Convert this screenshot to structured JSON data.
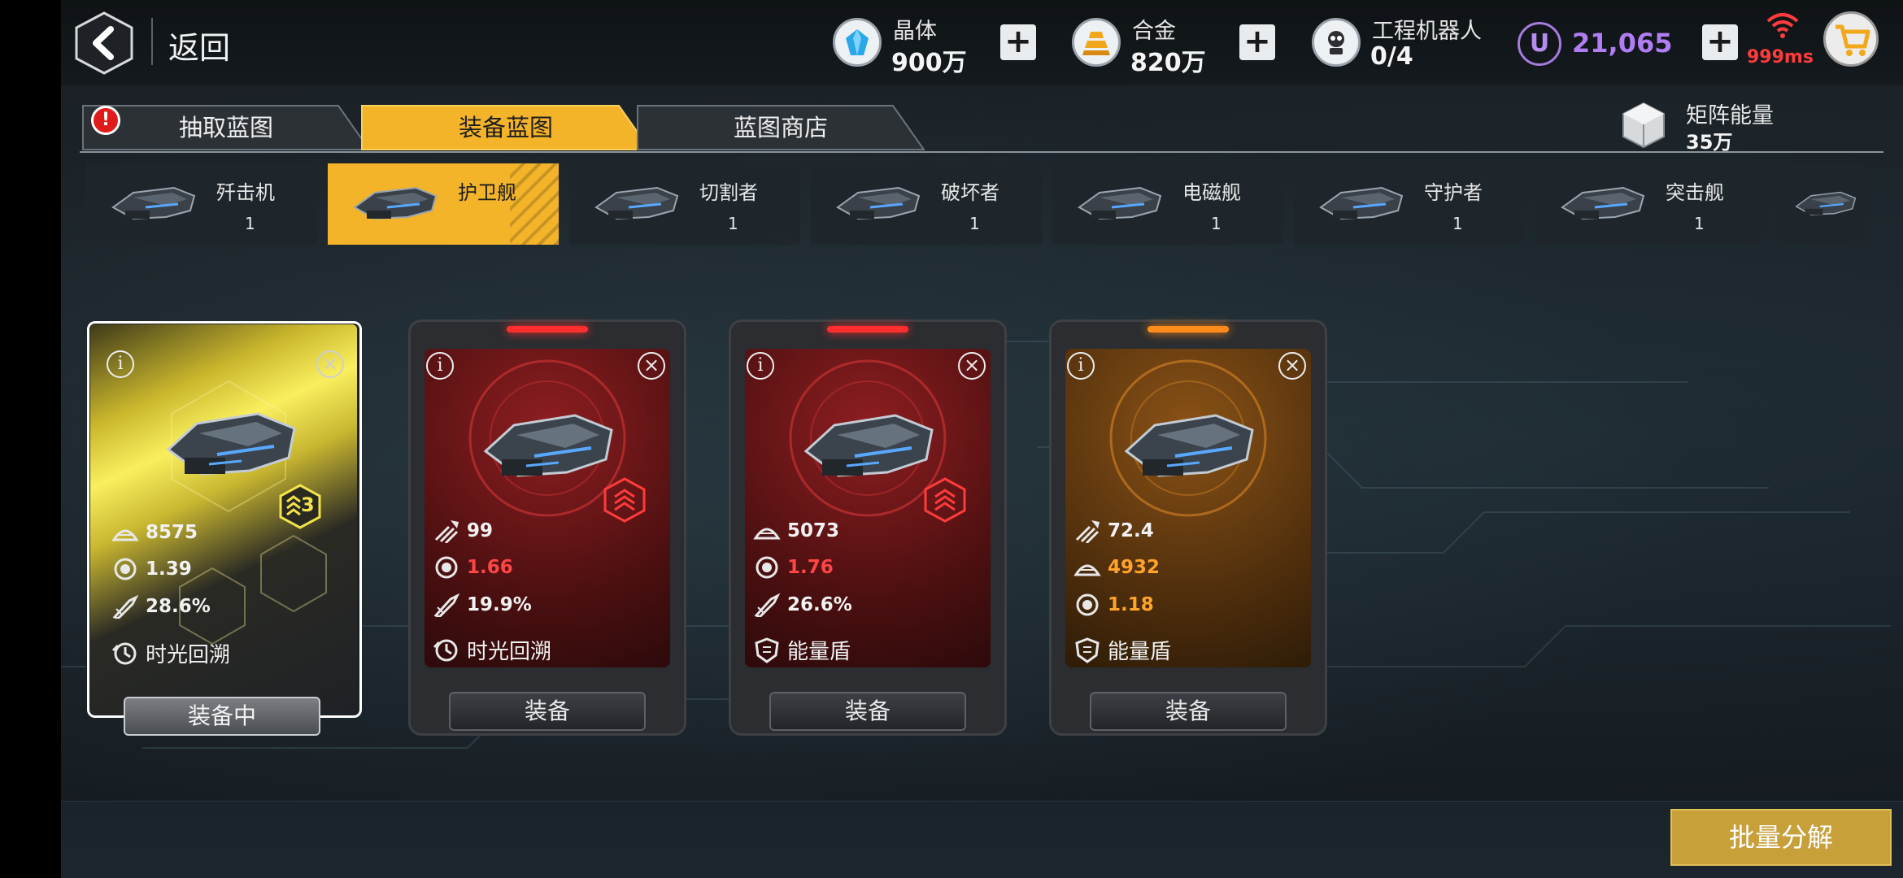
{
  "header": {
    "back_label": "返回",
    "resources": [
      {
        "name": "晶体",
        "value": "900万",
        "icon": "crystal-icon"
      },
      {
        "name": "合金",
        "value": "820万",
        "icon": "alloy-icon"
      },
      {
        "name": "工程机器人",
        "value": "0/4",
        "icon": "robot-icon"
      }
    ],
    "currency": {
      "symbol": "U",
      "value": "21,065"
    },
    "ping": "999ms"
  },
  "tabs": [
    {
      "label": "抽取蓝图",
      "active": false,
      "alert": "!"
    },
    {
      "label": "装备蓝图",
      "active": true
    },
    {
      "label": "蓝图商店",
      "active": false
    }
  ],
  "matrix": {
    "name": "矩阵能量",
    "value": "35万"
  },
  "ship_types": [
    {
      "name": "歼击机",
      "count": "1",
      "active": false
    },
    {
      "name": "护卫舰",
      "count": "",
      "active": true
    },
    {
      "name": "切割者",
      "count": "1",
      "active": false
    },
    {
      "name": "破坏者",
      "count": "1",
      "active": false
    },
    {
      "name": "电磁舰",
      "count": "1",
      "active": false
    },
    {
      "name": "守护者",
      "count": "1",
      "active": false
    },
    {
      "name": "突击舰",
      "count": "1",
      "active": false
    }
  ],
  "cards": [
    {
      "rarity": "gold",
      "rank": "3",
      "stats": [
        {
          "icon": "armor-icon",
          "value": "8575",
          "color": "white"
        },
        {
          "icon": "energy-icon",
          "value": "1.39",
          "color": "white"
        },
        {
          "icon": "rocket-icon",
          "value": "28.6%",
          "color": "white"
        }
      ],
      "skill": {
        "icon": "time-rewind-icon",
        "label": "时光回溯"
      },
      "button": "装备中"
    },
    {
      "rarity": "red",
      "stats": [
        {
          "icon": "damage-icon",
          "value": "99",
          "color": "white"
        },
        {
          "icon": "energy-icon",
          "value": "1.66",
          "color": "red"
        },
        {
          "icon": "rocket-icon",
          "value": "19.9%",
          "color": "white"
        }
      ],
      "skill": {
        "icon": "time-rewind-icon",
        "label": "时光回溯"
      },
      "button": "装备"
    },
    {
      "rarity": "red",
      "stats": [
        {
          "icon": "armor-icon",
          "value": "5073",
          "color": "white"
        },
        {
          "icon": "energy-icon",
          "value": "1.76",
          "color": "red"
        },
        {
          "icon": "rocket-icon",
          "value": "26.6%",
          "color": "white"
        }
      ],
      "skill": {
        "icon": "shield-icon",
        "label": "能量盾"
      },
      "button": "装备"
    },
    {
      "rarity": "orange",
      "stats": [
        {
          "icon": "damage-icon",
          "value": "72.4",
          "color": "white"
        },
        {
          "icon": "armor-icon",
          "value": "4932",
          "color": "orange"
        },
        {
          "icon": "energy-icon",
          "value": "1.18",
          "color": "orange"
        }
      ],
      "skill": {
        "icon": "shield-icon",
        "label": "能量盾"
      },
      "button": "装备"
    }
  ],
  "batch_button": "批量分解",
  "colors": {
    "accent_gold": "#f3b42a",
    "red": "#ff4646",
    "orange": "#ffa32a",
    "purple": "#b07ef2"
  }
}
